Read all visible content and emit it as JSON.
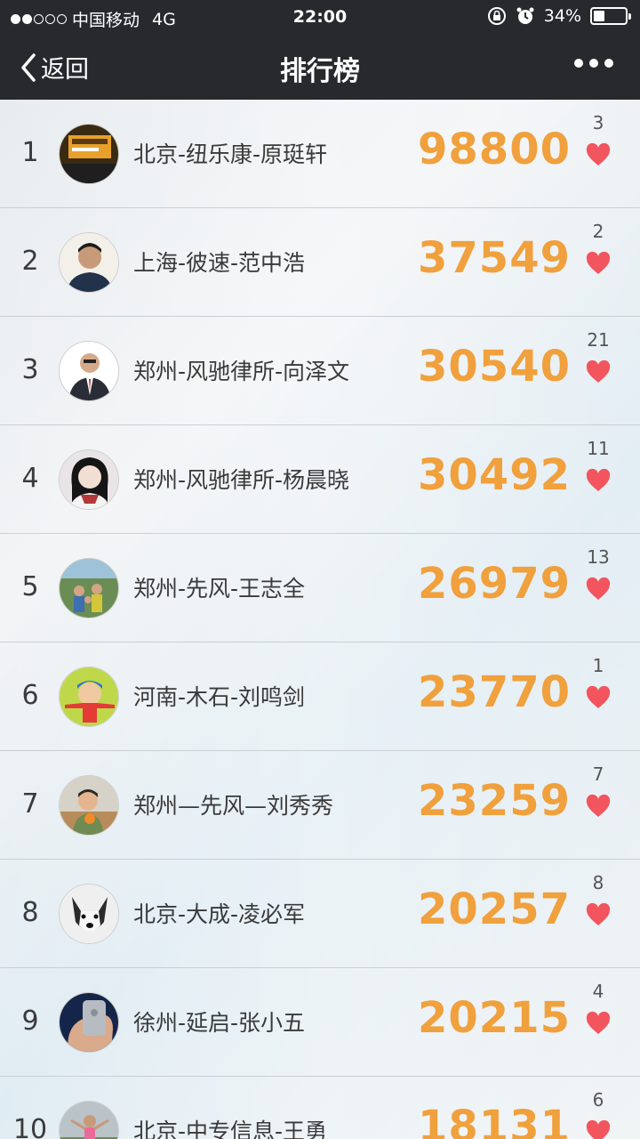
{
  "status": {
    "carrier": "中国移动",
    "network": "4G",
    "time": "22:00",
    "battery": "34%",
    "battery_level": 0.34,
    "signal_filled": 2,
    "signal_total": 5
  },
  "nav": {
    "back_label": "返回",
    "title": "排行榜"
  },
  "colors": {
    "score": "#f0a03c",
    "heart": "#f2555d",
    "bar": "#27292d"
  },
  "rows": [
    {
      "rank": "1",
      "name": "北京-纽乐康-原珽轩",
      "score": "98800",
      "likes": "3",
      "avatar": "avatar-sign"
    },
    {
      "rank": "2",
      "name": "上海-彼速-范中浩",
      "score": "37549",
      "likes": "2",
      "avatar": "avatar-man"
    },
    {
      "rank": "3",
      "name": "郑州-风驰律所-向泽文",
      "score": "30540",
      "likes": "21",
      "avatar": "avatar-suit"
    },
    {
      "rank": "4",
      "name": "郑州-风驰律所-杨晨晓",
      "score": "30492",
      "likes": "11",
      "avatar": "avatar-woman"
    },
    {
      "rank": "5",
      "name": "郑州-先风-王志全",
      "score": "26979",
      "likes": "13",
      "avatar": "avatar-group"
    },
    {
      "rank": "6",
      "name": "河南-木石-刘鸣剑",
      "score": "23770",
      "likes": "1",
      "avatar": "avatar-cartoon"
    },
    {
      "rank": "7",
      "name": "郑州—先风—刘秀秀",
      "score": "23259",
      "likes": "7",
      "avatar": "avatar-child"
    },
    {
      "rank": "8",
      "name": "北京-大成-凌必军",
      "score": "20257",
      "likes": "8",
      "avatar": "avatar-dog"
    },
    {
      "rank": "9",
      "name": "徐州-延启-张小五",
      "score": "20215",
      "likes": "4",
      "avatar": "avatar-hand"
    },
    {
      "rank": "10",
      "name": "北京-中专信息-王勇",
      "score": "18131",
      "likes": "6",
      "avatar": "avatar-outdoor"
    }
  ]
}
